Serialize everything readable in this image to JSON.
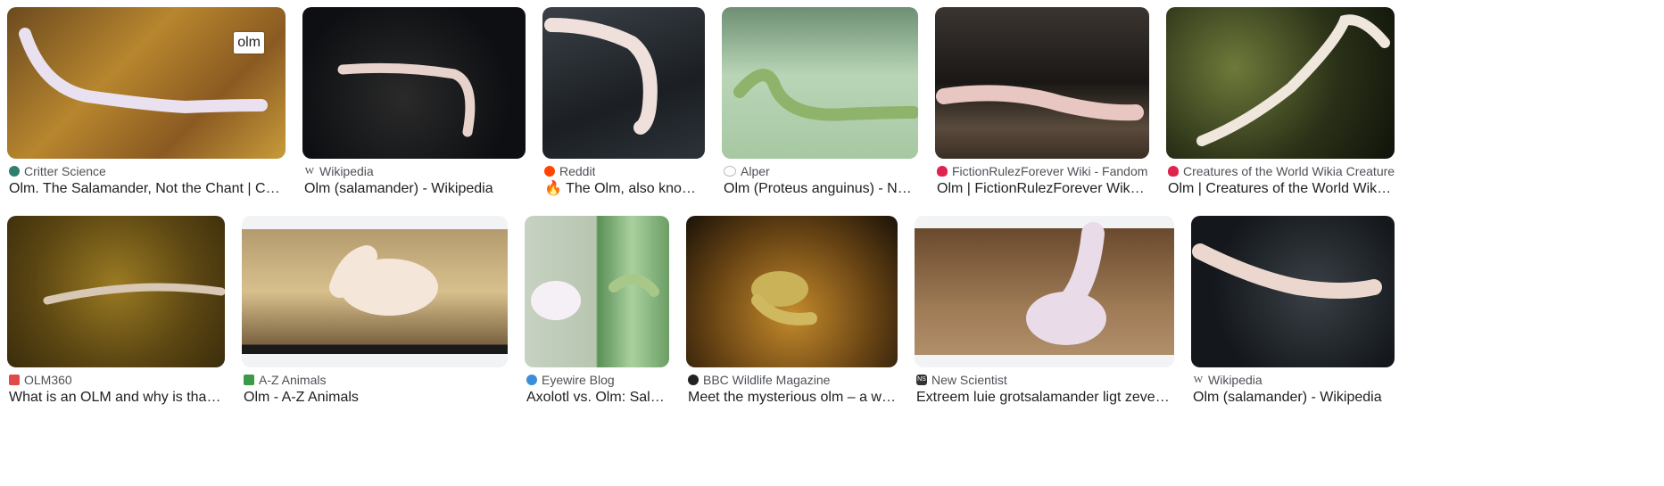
{
  "results": [
    {
      "source": "Critter Science",
      "title": "Olm. The Salamander, Not the Chant | Critter S...",
      "badge": "olm",
      "fav_color": "#2f7f6f"
    },
    {
      "source": "Wikipedia",
      "title": "Olm (salamander) - Wikipedia",
      "fav_color": "#666666",
      "fav_icon": "W"
    },
    {
      "source": "Reddit",
      "title": "🔥 The Olm, also known a...",
      "fav_color": "#ff4500"
    },
    {
      "source": "Alper",
      "title": "Olm (Proteus anguinus) - Nation...",
      "fav_color": "#bbbbbb"
    },
    {
      "source": "FictionRulezForever Wiki - Fandom",
      "title": "Olm | FictionRulezForever Wiki | Fa...",
      "fav_color": "#e0234e"
    },
    {
      "source": "Creatures of the World Wikia Creatures of ...",
      "title": "Olm | Creatures of the World Wikia | F...",
      "fav_color": "#e0234e"
    },
    {
      "source": "OLM360",
      "title": "What is an OLM and why is that on o...",
      "fav_color": "#e04a4a"
    },
    {
      "source": "A-Z Animals",
      "title": "Olm - A-Z Animals",
      "fav_color": "#3a9a4a"
    },
    {
      "source": "Eyewire Blog",
      "title": "Axolotl vs. Olm: Salam...",
      "fav_color": "#3b8fd9"
    },
    {
      "source": "BBC Wildlife Magazine",
      "title": "Meet the mysterious olm – a weird ...",
      "fav_color": "#222222"
    },
    {
      "source": "New Scientist",
      "title": "Extreem luie grotsalamander ligt zeven jaar ...",
      "fav_color": "#333333",
      "fav_icon": "NS"
    },
    {
      "source": "Wikipedia",
      "title": "Olm (salamander) - Wikipedia",
      "fav_color": "#666666",
      "fav_icon": "W"
    }
  ]
}
